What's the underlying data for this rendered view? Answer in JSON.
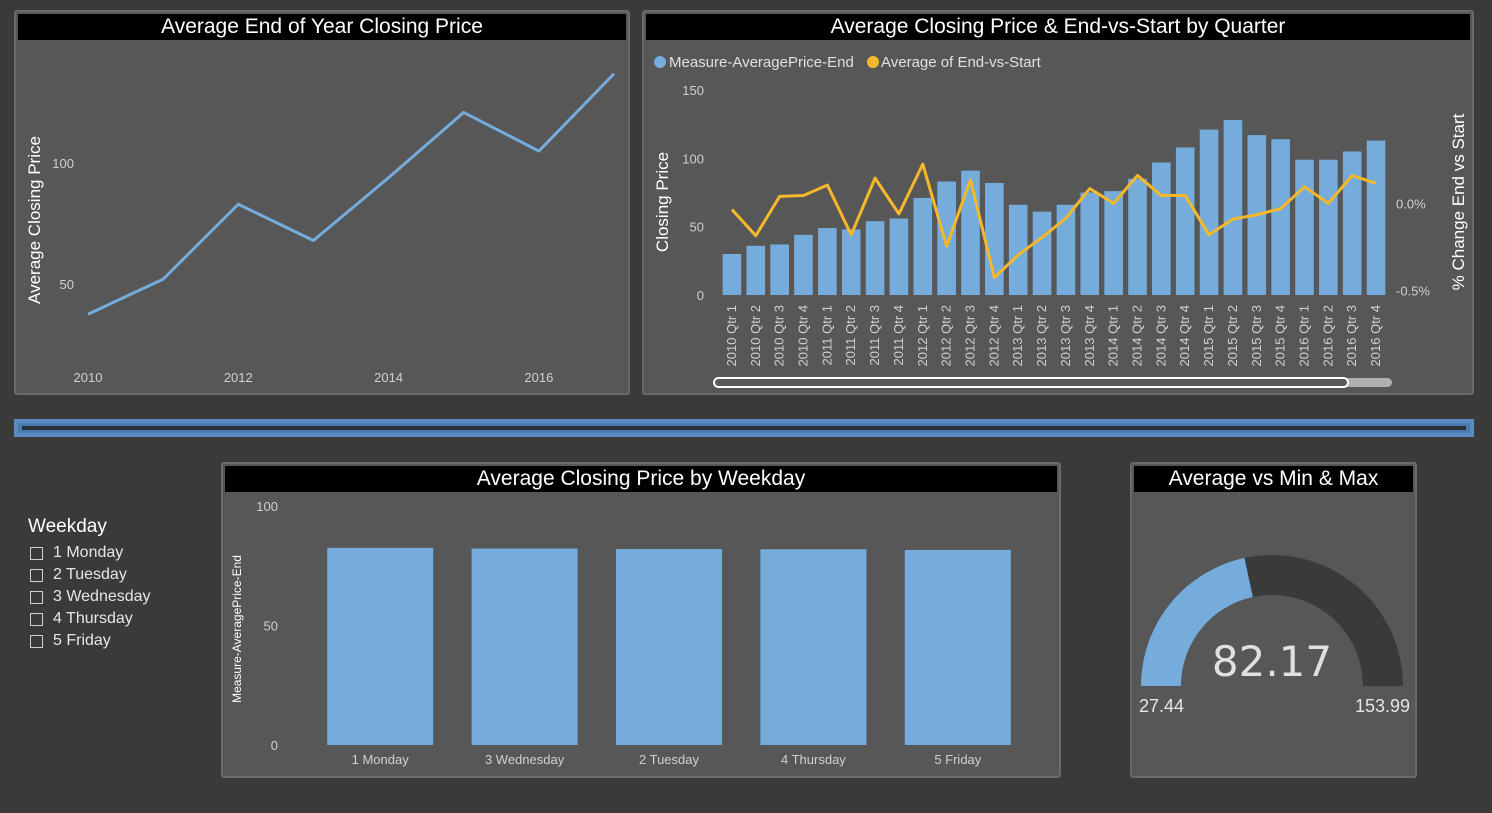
{
  "colors": {
    "bar": "#75acdb",
    "line": "#75acdb",
    "pct_line": "#f5b82a",
    "gauge_empty": "#3a3a3a",
    "panel": "#575757"
  },
  "panels": {
    "yearly": {
      "title": "Average End of Year Closing Price"
    },
    "quarterly": {
      "title": "Average Closing Price & End-vs-Start by Quarter"
    },
    "weekday": {
      "title": "Average Closing Price by Weekday"
    },
    "gauge": {
      "title": "Average vs Min & Max"
    }
  },
  "slicer": {
    "title": "Weekday",
    "items": [
      "1 Monday",
      "2 Tuesday",
      "3 Wednesday",
      "4 Thursday",
      "5 Friday"
    ]
  },
  "chart_data": [
    {
      "id": "yearly",
      "type": "line",
      "title": "Average End of Year Closing Price",
      "ylabel": "Average Closing Price",
      "x": [
        2010,
        2011,
        2012,
        2013,
        2014,
        2015,
        2016,
        2017
      ],
      "values": [
        37.5,
        52,
        83,
        68,
        94,
        121,
        105,
        137
      ],
      "xticks": [
        "2010",
        "2012",
        "2014",
        "2016"
      ],
      "yticks": [
        50,
        100
      ],
      "ylim": [
        26,
        146
      ]
    },
    {
      "id": "quarterly",
      "type": "bar",
      "title": "Average Closing Price & End-vs-Start by Quarter",
      "ylabel": "Closing Price",
      "y2label": "% Change End vs Start",
      "legend": [
        "Measure-AveragePrice-End",
        "Average of End-vs-Start"
      ],
      "categories": [
        "2010 Qtr 1",
        "2010 Qtr 2",
        "2010 Qtr 3",
        "2010 Qtr 4",
        "2011 Qtr 1",
        "2011 Qtr 2",
        "2011 Qtr 3",
        "2011 Qtr 4",
        "2012 Qtr 1",
        "2012 Qtr 2",
        "2012 Qtr 3",
        "2012 Qtr 4",
        "2013 Qtr 1",
        "2013 Qtr 2",
        "2013 Qtr 3",
        "2013 Qtr 4",
        "2014 Qtr 1",
        "2014 Qtr 2",
        "2014 Qtr 3",
        "2014 Qtr 4",
        "2015 Qtr 1",
        "2015 Qtr 2",
        "2015 Qtr 3",
        "2015 Qtr 4",
        "2016 Qtr 1",
        "2016 Qtr 2",
        "2016 Qtr 3",
        "2016 Qtr 4"
      ],
      "series": [
        {
          "name": "Measure-AveragePrice-End",
          "axis": "left",
          "values": [
            30,
            36,
            37,
            44,
            49,
            48,
            54,
            56,
            71,
            83,
            91,
            82,
            66,
            61,
            66,
            75,
            76,
            85,
            97,
            108,
            121,
            128,
            117,
            114,
            99,
            99,
            105,
            113
          ]
        },
        {
          "name": "Average of End-vs-Start",
          "axis": "right",
          "values": [
            -0.0035,
            -0.0185,
            0.004,
            0.0045,
            0.0105,
            -0.018,
            0.0145,
            -0.006,
            0.0225,
            -0.0245,
            0.0135,
            -0.0425,
            -0.0295,
            -0.0195,
            -0.0085,
            0.0085,
            0.0,
            0.016,
            0.0045,
            0.0045,
            -0.018,
            -0.009,
            -0.0065,
            -0.003,
            0.0095,
            0.0,
            0.016,
            0.0115
          ]
        }
      ],
      "yticks": [
        0,
        50,
        100,
        150
      ],
      "ylim": [
        0,
        150
      ],
      "y2ticks": [
        "0.0%",
        "-0.5%"
      ],
      "y2tick_values": [
        0.0,
        -0.05
      ],
      "y2lim": [
        -0.0525,
        0.065
      ]
    },
    {
      "id": "weekday",
      "type": "bar",
      "title": "Average Closing Price by Weekday",
      "ylabel": "Measure-AveragePrice-End",
      "categories": [
        "1 Monday",
        "3 Wednesday",
        "2 Tuesday",
        "4 Thursday",
        "5 Friday"
      ],
      "values": [
        82.5,
        82.2,
        82.0,
        81.9,
        81.6
      ],
      "yticks": [
        0,
        50,
        100
      ],
      "ylim": [
        0,
        100
      ]
    },
    {
      "id": "gauge",
      "type": "gauge",
      "title": "Average vs Min & Max",
      "value": 82.17,
      "value_label": "82.17",
      "min": 27.44,
      "min_label": "27.44",
      "max": 153.99,
      "max_label": "153.99"
    }
  ]
}
